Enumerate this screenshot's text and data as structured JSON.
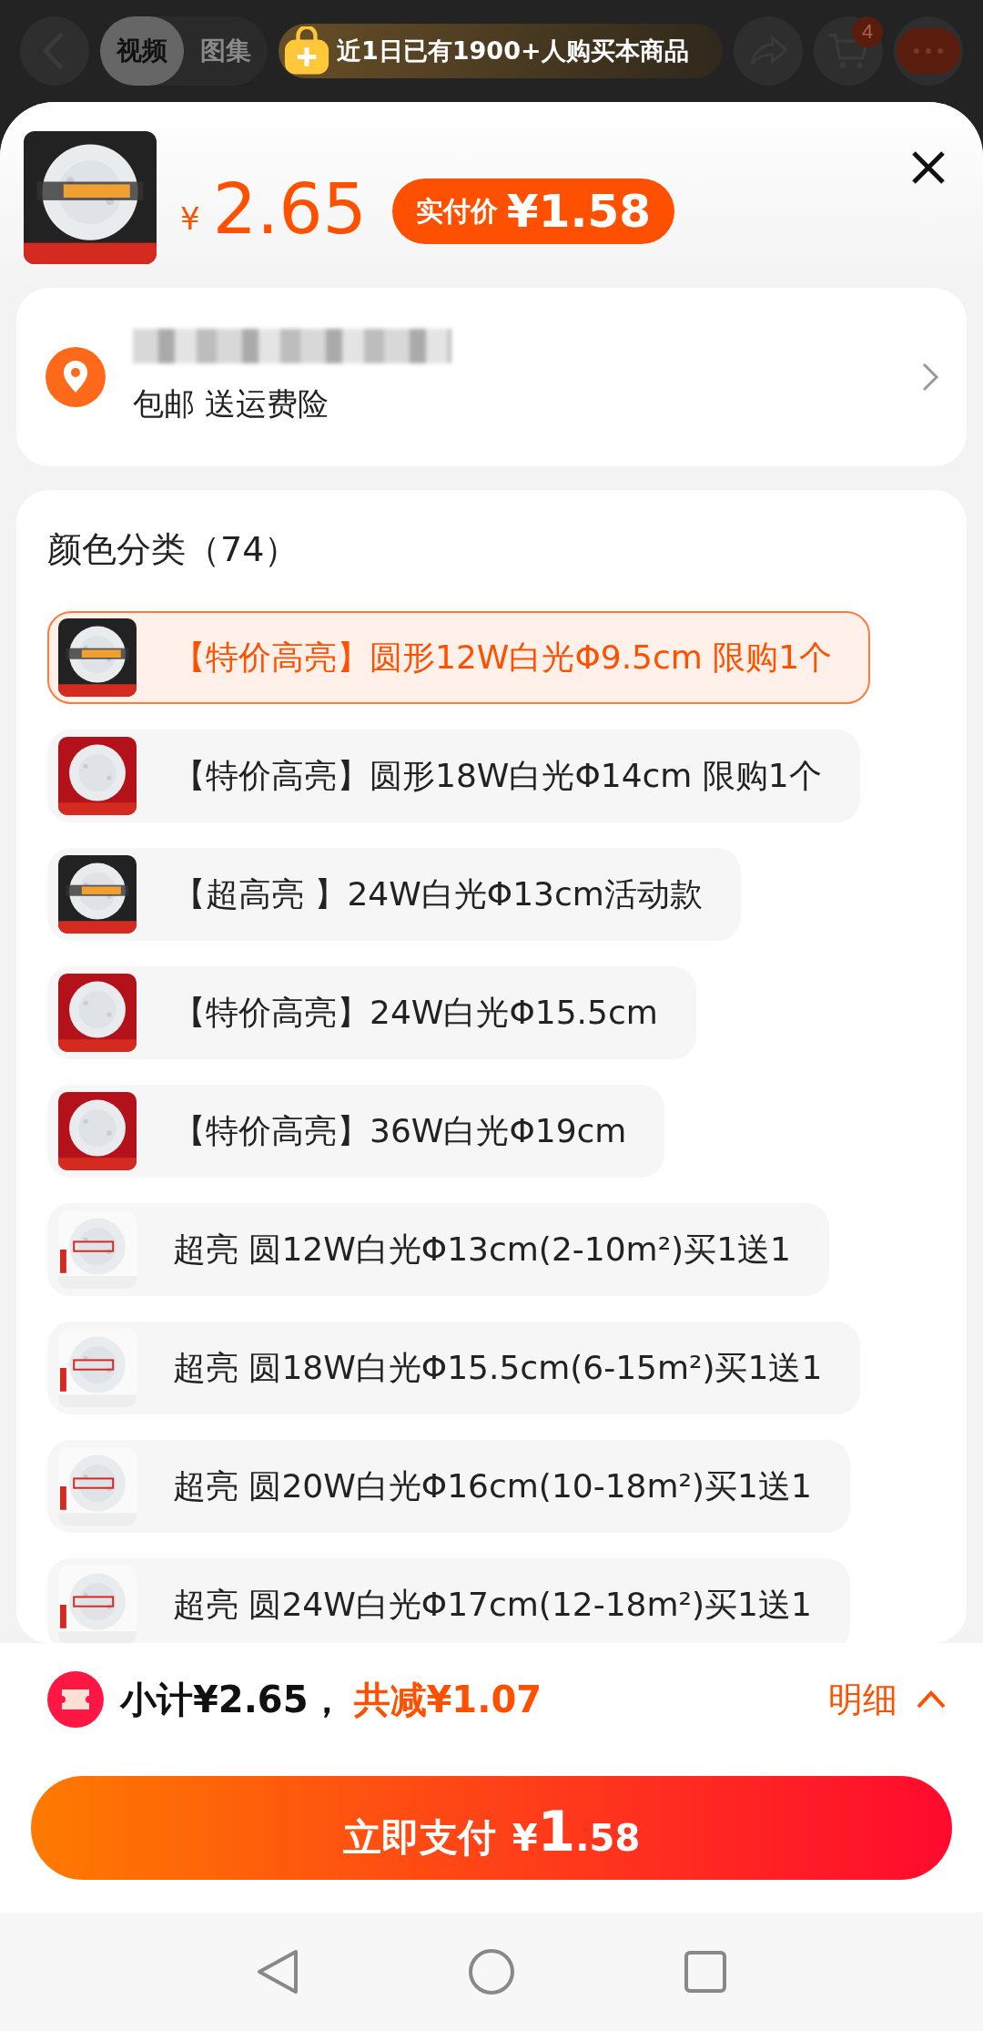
{
  "background_header": {
    "tabs": [
      {
        "label": "视频",
        "selected": true
      },
      {
        "label": "图集",
        "selected": false
      }
    ],
    "cart_badge": "4"
  },
  "banner": {
    "text": "近1日已有1900+人购买本商品"
  },
  "product": {
    "currency": "¥",
    "price": "2.65",
    "final_label": "实付价",
    "final_price": "¥1.58"
  },
  "shipping": {
    "text": "包邮 送运费险"
  },
  "options": {
    "title": "颜色分类（74）",
    "items": [
      {
        "label": "【特价高亮】圆形12W白光Φ9.5cm 限购1个",
        "selected": true
      },
      {
        "label": "【特价高亮】圆形18W白光Φ14cm 限购1个",
        "selected": false
      },
      {
        "label": "【超高亮 】24W白光Φ13cm活动款",
        "selected": false
      },
      {
        "label": "【特价高亮】24W白光Φ15.5cm",
        "selected": false
      },
      {
        "label": "【特价高亮】36W白光Φ19cm",
        "selected": false
      },
      {
        "label": "超亮 圆12W白光Φ13cm(2-10m²)买1送1",
        "selected": false
      },
      {
        "label": "超亮 圆18W白光Φ15.5cm(6-15m²)买1送1",
        "selected": false
      },
      {
        "label": "超亮 圆20W白光Φ16cm(10-18m²)买1送1",
        "selected": false
      },
      {
        "label": "超亮 圆24W白光Φ17cm(12-18m²)买1送1",
        "selected": false
      }
    ]
  },
  "summary": {
    "subtotal": "小计¥2.65，",
    "discount": "共减¥1.07",
    "detail": "明细"
  },
  "pay_button": {
    "label": "立即支付",
    "currency": "¥",
    "integer": "1",
    "decimal": ".58"
  }
}
